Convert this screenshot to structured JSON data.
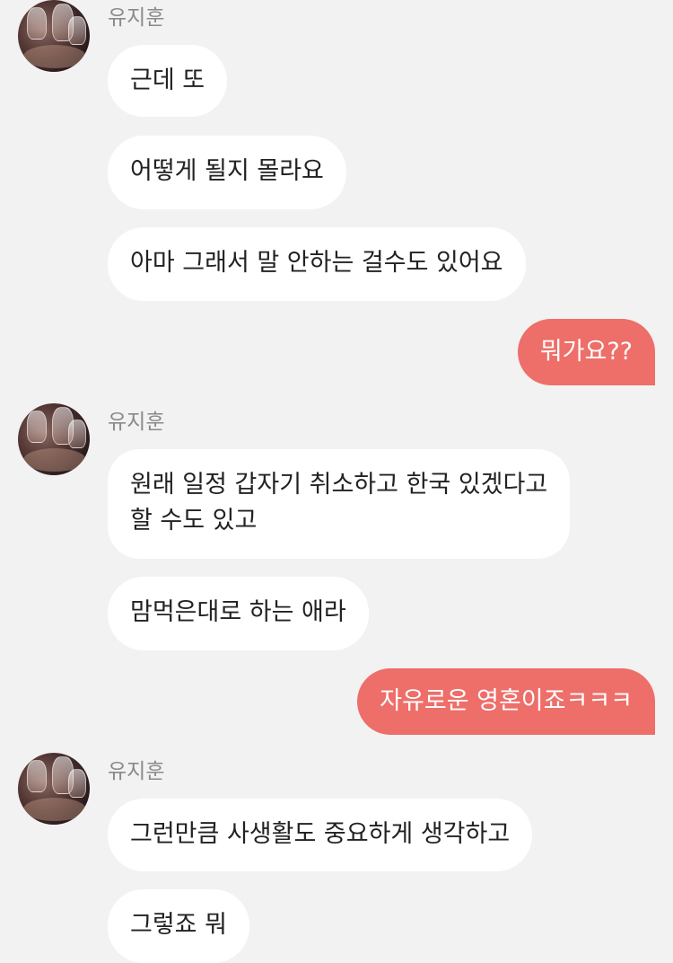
{
  "chat": {
    "messages": [
      {
        "sender": "유지훈",
        "text": "근데 또"
      },
      {
        "text": "어떻게 될지 몰라요"
      },
      {
        "text": "아마 그래서 말 안하는 걸수도 있어요"
      },
      {
        "from_me": true,
        "text": "뭐가요??"
      },
      {
        "sender": "유지훈",
        "text_lines": [
          "원래 일정 갑자기 취소하고 한국 있겠다고",
          "할 수도 있고"
        ]
      },
      {
        "text": "맘먹은대로 하는 애라"
      },
      {
        "from_me": true,
        "text": "자유로운 영혼이죠ㅋㅋㅋ"
      },
      {
        "sender": "유지훈",
        "text": "그런만큼 사생활도 중요하게 생각하고"
      },
      {
        "text": "그렇죠 뭐"
      }
    ]
  },
  "colors": {
    "background": "#f2f2f2",
    "incoming_bubble": "#ffffff",
    "outgoing_bubble": "#ee6e69",
    "sender_name": "#8a8a8a"
  },
  "icons": {
    "avatar": "avatar-photo-wine-glasses"
  }
}
